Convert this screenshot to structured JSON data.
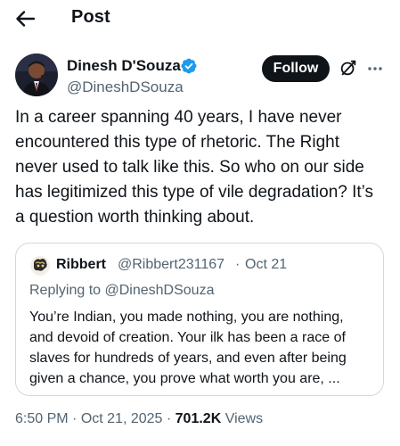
{
  "header": {
    "title": "Post"
  },
  "author": {
    "name": "Dinesh D'Souza",
    "handle": "@DineshDSouza",
    "follow_label": "Follow",
    "verified_color": "#1d9bf0"
  },
  "post": {
    "text": "In a career spanning 40 years, I have never\nencountered this type of rhetoric. The Right\nnever used to talk like this. So who on our side\nhas legitimized this type of vile degradation? It’s\na question worth thinking about."
  },
  "quote": {
    "name": "Ribbert",
    "handle": "@Ribbert231167",
    "separator": "·",
    "date": "Oct 21",
    "replying_to": "Replying to @DineshDSouza",
    "text": "You’re Indian, you made nothing, you are nothing,\nand devoid of creation. Your ilk has been a race of\nslaves for hundreds of years, and even after being\ngiven a chance, you prove what worth you are, ..."
  },
  "meta": {
    "time": "6:50 PM",
    "separator1": " · ",
    "date": "Oct 21, 2025",
    "separator2": " · ",
    "views_count": "701.2K",
    "views_label": " Views"
  },
  "icons": {
    "back": "arrow-left-icon",
    "verified": "verified-badge-icon",
    "grok": "grok-icon",
    "more": "more-horizontal-icon"
  }
}
